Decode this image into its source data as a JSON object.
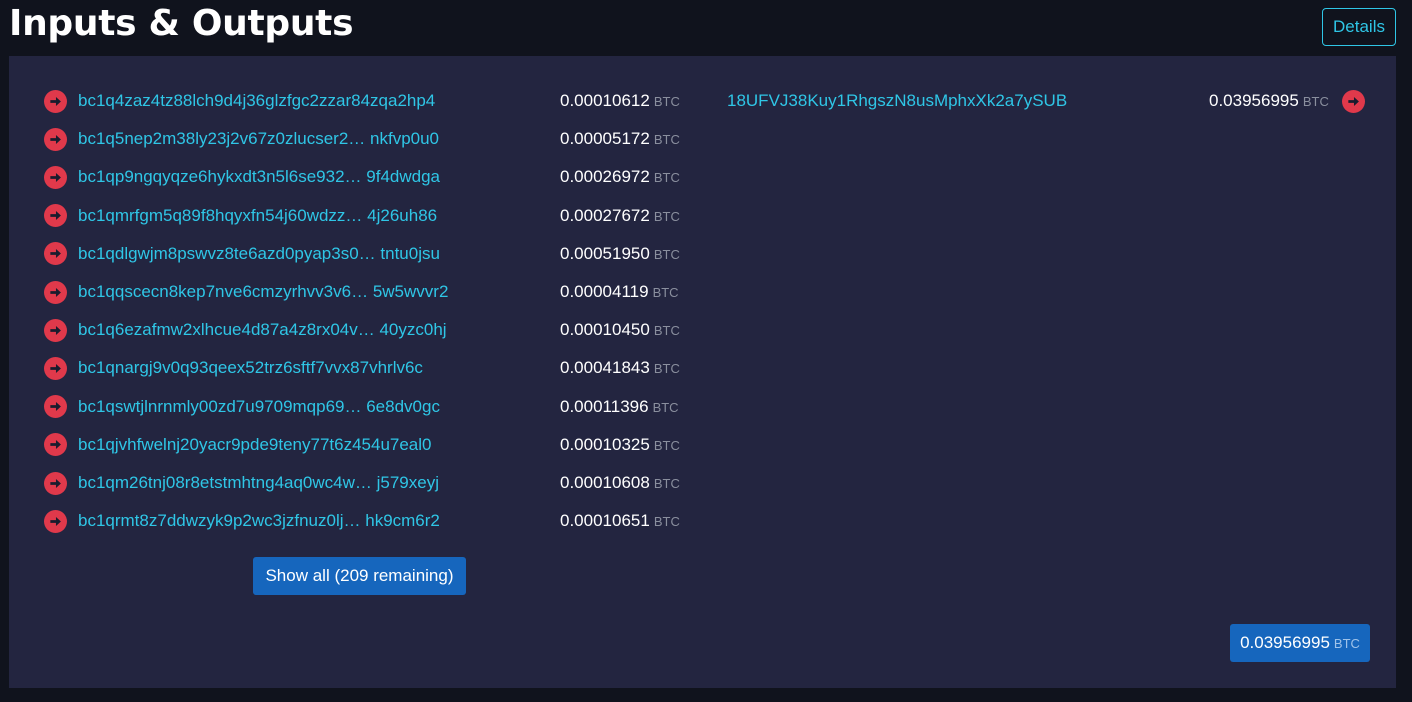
{
  "header": {
    "title": "Inputs & Outputs",
    "details_label": "Details"
  },
  "inputs": [
    {
      "address": "bc1q4zaz4tz88lch9d4j36glzfgc2zzar84zqa2hp4",
      "amount": "0.00010612",
      "unit": "BTC"
    },
    {
      "address": "bc1q5nep2m38ly23j2v67z0zlucser2…  nkfvp0u0",
      "amount": "0.00005172",
      "unit": "BTC"
    },
    {
      "address": "bc1qp9ngqyqze6hykxdt3n5l6se932… 9f4dwdga",
      "amount": "0.00026972",
      "unit": "BTC"
    },
    {
      "address": "bc1qmrfgm5q89f8hqyxfn54j60wdzz… 4j26uh86",
      "amount": "0.00027672",
      "unit": "BTC"
    },
    {
      "address": "bc1qdlgwjm8pswvz8te6azd0pyap3s0… tntu0jsu",
      "amount": "0.00051950",
      "unit": "BTC"
    },
    {
      "address": "bc1qqscecn8kep7nve6cmzyrhvv3v6… 5w5wvvr2",
      "amount": "0.00004119",
      "unit": "BTC"
    },
    {
      "address": "bc1q6ezafmw2xlhcue4d87a4z8rx04v… 40yzc0hj",
      "amount": "0.00010450",
      "unit": "BTC"
    },
    {
      "address": "bc1qnargj9v0q93qeex52trz6sftf7vvx87vhrlv6c",
      "amount": "0.00041843",
      "unit": "BTC"
    },
    {
      "address": "bc1qswtjlnrnmly00zd7u9709mqp69… 6e8dv0gc",
      "amount": "0.00011396",
      "unit": "BTC"
    },
    {
      "address": "bc1qjvhfwelnj20yacr9pde9teny77t6z454u7eal0",
      "amount": "0.00010325",
      "unit": "BTC"
    },
    {
      "address": "bc1qm26tnj08r8etstmhtng4aq0wc4w… j579xeyj",
      "amount": "0.00010608",
      "unit": "BTC"
    },
    {
      "address": "bc1qrmt8z7ddwzyk9p2wc3jzfnuz0lj… hk9cm6r2",
      "amount": "0.00010651",
      "unit": "BTC"
    }
  ],
  "show_all_label": "Show all (209 remaining)",
  "outputs": [
    {
      "address": "18UFVJ38Kuy1RhgszN8usMphxXk2a7ySUB",
      "amount": "0.03956995",
      "unit": "BTC"
    }
  ],
  "total": {
    "amount": "0.03956995",
    "unit": "BTC"
  },
  "colors": {
    "background": "#10131d",
    "panel": "#232540",
    "link": "#2fc6e6",
    "arrow": "#e0394b",
    "button": "#1666bd"
  },
  "icons": {
    "input_arrow": "arrow-right-circle-icon",
    "output_arrow": "arrow-right-circle-icon"
  }
}
